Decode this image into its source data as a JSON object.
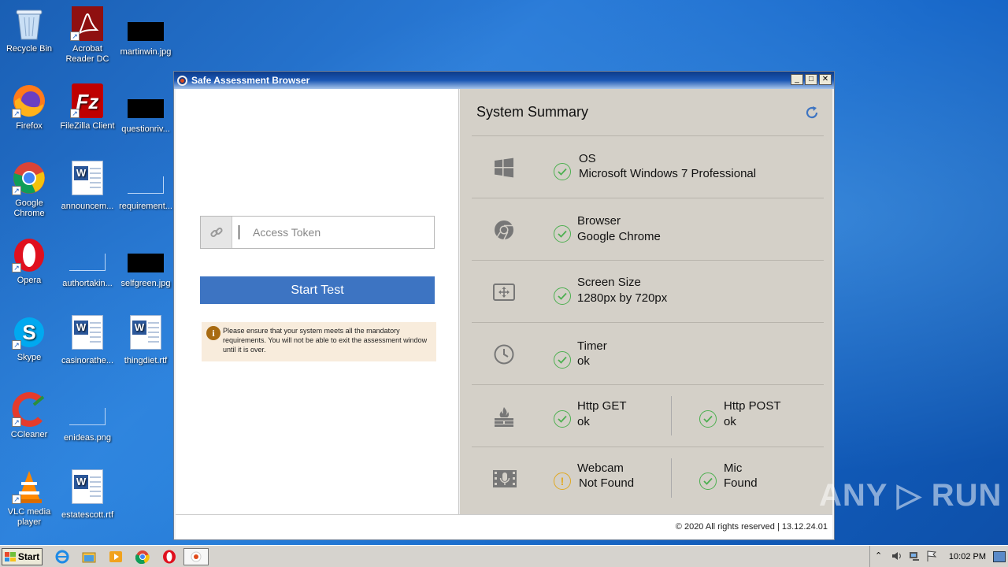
{
  "desktop": {
    "icons": [
      {
        "label": "Recycle Bin"
      },
      {
        "label": "Acrobat Reader DC"
      },
      {
        "label": "martinwin.jpg"
      },
      {
        "label": "Firefox"
      },
      {
        "label": "FileZilla Client"
      },
      {
        "label": "questionriv..."
      },
      {
        "label": "Google Chrome"
      },
      {
        "label": "announcem..."
      },
      {
        "label": "requirement..."
      },
      {
        "label": "Opera"
      },
      {
        "label": "authortakin..."
      },
      {
        "label": "selfgreen.jpg"
      },
      {
        "label": "Skype"
      },
      {
        "label": "casinorathe..."
      },
      {
        "label": "thingdiet.rtf"
      },
      {
        "label": "CCleaner"
      },
      {
        "label": "enideas.png"
      },
      {
        "label": "VLC media player"
      },
      {
        "label": "estatescott.rtf"
      }
    ]
  },
  "window": {
    "title": "Safe Assessment Browser",
    "buttons": {
      "minimize": "_",
      "maximize": "□",
      "close": "✕"
    }
  },
  "left": {
    "token_placeholder": "Access Token",
    "start_label": "Start Test",
    "notice": "Please ensure that your system meets all the mandatory requirements. You will not be able to exit the assessment window until it is over."
  },
  "summary": {
    "title": "System Summary",
    "os": {
      "label": "OS",
      "value": "Microsoft Windows 7 Professional"
    },
    "browser": {
      "label": "Browser",
      "value": "Google Chrome"
    },
    "screen": {
      "label": "Screen Size",
      "value": "1280px by 720px"
    },
    "timer": {
      "label": "Timer",
      "value": "ok"
    },
    "http_get": {
      "label": "Http GET",
      "value": "ok"
    },
    "http_post": {
      "label": "Http POST",
      "value": "ok"
    },
    "webcam": {
      "label": "Webcam",
      "value": "Not Found"
    },
    "mic": {
      "label": "Mic",
      "value": "Found"
    }
  },
  "footer": {
    "text": "© 2020 All rights reserved | 13.12.24.01"
  },
  "taskbar": {
    "start_label": "Start",
    "clock": "10:02 PM"
  },
  "watermark": {
    "text": "ANY ▷ RUN"
  },
  "colors": {
    "accent": "#3d74c2",
    "ok": "#4caf50",
    "warn": "#e0a820",
    "notice_bg": "#f8ecdc"
  }
}
